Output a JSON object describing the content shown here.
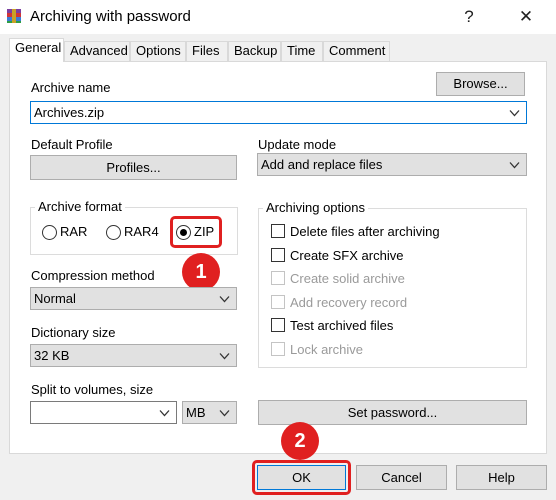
{
  "window": {
    "title": "Archiving with password",
    "help_glyph": "?",
    "close_glyph": "✕"
  },
  "tabs": [
    {
      "label": "General",
      "active": true
    },
    {
      "label": "Advanced"
    },
    {
      "label": "Options"
    },
    {
      "label": "Files"
    },
    {
      "label": "Backup"
    },
    {
      "label": "Time"
    },
    {
      "label": "Comment"
    }
  ],
  "archive_name": {
    "label": "Archive name",
    "value": "Archives.zip",
    "browse_label": "Browse..."
  },
  "default_profile": {
    "label": "Default Profile",
    "button_label": "Profiles..."
  },
  "update_mode": {
    "label": "Update mode",
    "value": "Add and replace files"
  },
  "archive_format": {
    "label": "Archive format",
    "options": [
      {
        "label": "RAR",
        "checked": false
      },
      {
        "label": "RAR4",
        "checked": false
      },
      {
        "label": "ZIP",
        "checked": true
      }
    ]
  },
  "archiving_options": {
    "label": "Archiving options",
    "items": [
      {
        "label": "Delete files after archiving",
        "checked": false,
        "enabled": true
      },
      {
        "label": "Create SFX archive",
        "checked": false,
        "enabled": true
      },
      {
        "label": "Create solid archive",
        "checked": false,
        "enabled": false
      },
      {
        "label": "Add recovery record",
        "checked": false,
        "enabled": false
      },
      {
        "label": "Test archived files",
        "checked": false,
        "enabled": true
      },
      {
        "label": "Lock archive",
        "checked": false,
        "enabled": false
      }
    ]
  },
  "compression_method": {
    "label": "Compression method",
    "value": "Normal"
  },
  "dictionary_size": {
    "label": "Dictionary size",
    "value": "32 KB"
  },
  "split_volumes": {
    "label": "Split to volumes, size",
    "value": "",
    "unit": "MB"
  },
  "set_password_label": "Set password...",
  "footer": {
    "ok_label": "OK",
    "cancel_label": "Cancel",
    "help_label": "Help"
  },
  "annotations": {
    "step1": "1",
    "step2": "2",
    "color": "#e02020"
  }
}
